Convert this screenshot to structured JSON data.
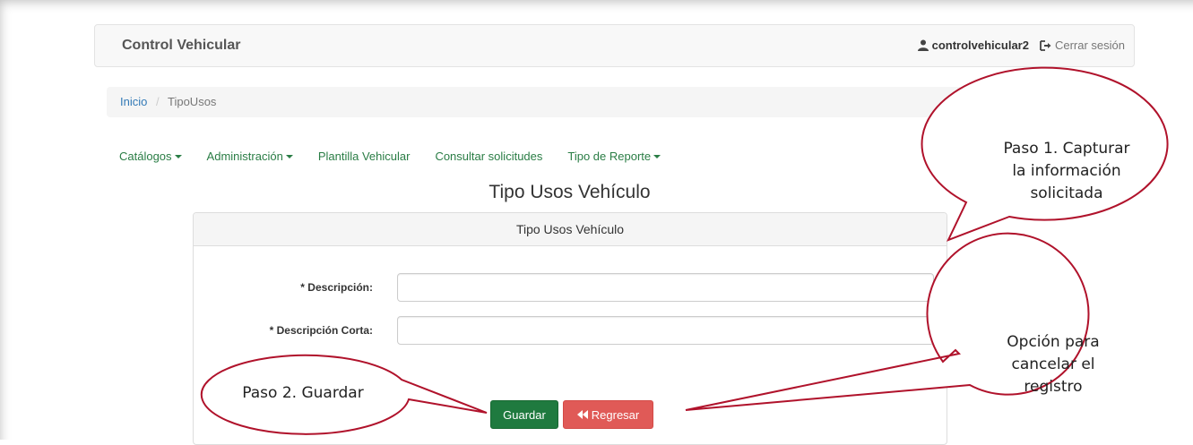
{
  "navbar": {
    "brand": "Control Vehicular",
    "username": "controlvehicular2",
    "logout_label": "Cerrar sesión"
  },
  "breadcrumb": {
    "home": "Inicio",
    "separator": "/",
    "current": "TipoUsos"
  },
  "menu": {
    "items": [
      {
        "label": "Catálogos",
        "dropdown": true
      },
      {
        "label": "Administración",
        "dropdown": true
      },
      {
        "label": "Plantilla Vehicular",
        "dropdown": false
      },
      {
        "label": "Consultar solicitudes",
        "dropdown": false
      },
      {
        "label": "Tipo de Reporte",
        "dropdown": true
      }
    ]
  },
  "page": {
    "title": "Tipo Usos Vehículo"
  },
  "form": {
    "panel_title": "Tipo Usos Vehículo",
    "descripcion_label": "* Descripción:",
    "descripcion_value": "",
    "descripcion_corta_label": "* Descripción Corta:",
    "descripcion_corta_value": "",
    "save_label": "Guardar",
    "back_label": "Regresar"
  },
  "callouts": {
    "step1": [
      "Paso 1. Capturar",
      "la información",
      "solicitada"
    ],
    "step2": "Paso 2. Guardar",
    "cancel": [
      "Opción para",
      "cancelar el",
      "registro"
    ]
  },
  "colors": {
    "menu_link": "#2a7d45",
    "save_button": "#1f7a3f",
    "back_button": "#e05a57",
    "callout_border": "#b0122b"
  }
}
